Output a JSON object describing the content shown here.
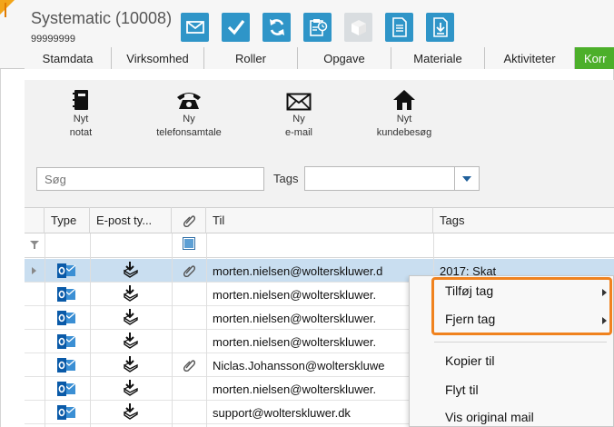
{
  "header": {
    "title": "Systematic (10008)",
    "subtitle": "99999999",
    "toolbar_icons": [
      "envelope-icon",
      "checkmark-icon",
      "refresh-icon",
      "clipboard-clock-icon",
      "box-icon",
      "document-icon",
      "download-document-icon"
    ]
  },
  "tabs": [
    "Stamdata",
    "Virksomhed",
    "Roller",
    "Opgave",
    "Materiale",
    "Aktiviteter",
    "Korr"
  ],
  "active_tab": "Korr",
  "actions": [
    {
      "line1": "Nyt",
      "line2": "notat",
      "icon": "notebook-icon"
    },
    {
      "line1": "Ny",
      "line2": "telefonsamtale",
      "icon": "telephone-icon"
    },
    {
      "line1": "Ny",
      "line2": "e-mail",
      "icon": "envelope-icon"
    },
    {
      "line1": "Nyt",
      "line2": "kundebesøg",
      "icon": "house-icon"
    }
  ],
  "search": {
    "placeholder": "Søg",
    "tags_label": "Tags",
    "tags_value": ""
  },
  "grid": {
    "columns": [
      "Type",
      "E-post ty...",
      "",
      "Til",
      "Tags"
    ],
    "rows": [
      {
        "to": "morten.nielsen@wolterskluwer.d",
        "tags": "2017: Skat",
        "attachment": true,
        "selected": true
      },
      {
        "to": "morten.nielsen@wolterskluwer.",
        "tags": "",
        "attachment": false,
        "selected": false
      },
      {
        "to": "morten.nielsen@wolterskluwer.",
        "tags": "",
        "attachment": false,
        "selected": false
      },
      {
        "to": "morten.nielsen@wolterskluwer.",
        "tags": "",
        "attachment": false,
        "selected": false
      },
      {
        "to": "Niclas.Johansson@wolterskluwe",
        "tags": "",
        "attachment": true,
        "selected": false
      },
      {
        "to": "morten.nielsen@wolterskluwer.",
        "tags": "",
        "attachment": false,
        "selected": false
      },
      {
        "to": "support@wolterskluwer.dk",
        "tags": "",
        "attachment": false,
        "selected": false
      }
    ]
  },
  "context_menu": {
    "items": [
      "Tilføj tag",
      "Fjern tag",
      "Kopier til",
      "Flyt til",
      "Vis original mail"
    ],
    "highlight_color": "#f0821e"
  },
  "colors": {
    "accent_blue": "#2f95c8",
    "active_tab_green": "#4caf2a",
    "selected_row": "#c9def0"
  }
}
